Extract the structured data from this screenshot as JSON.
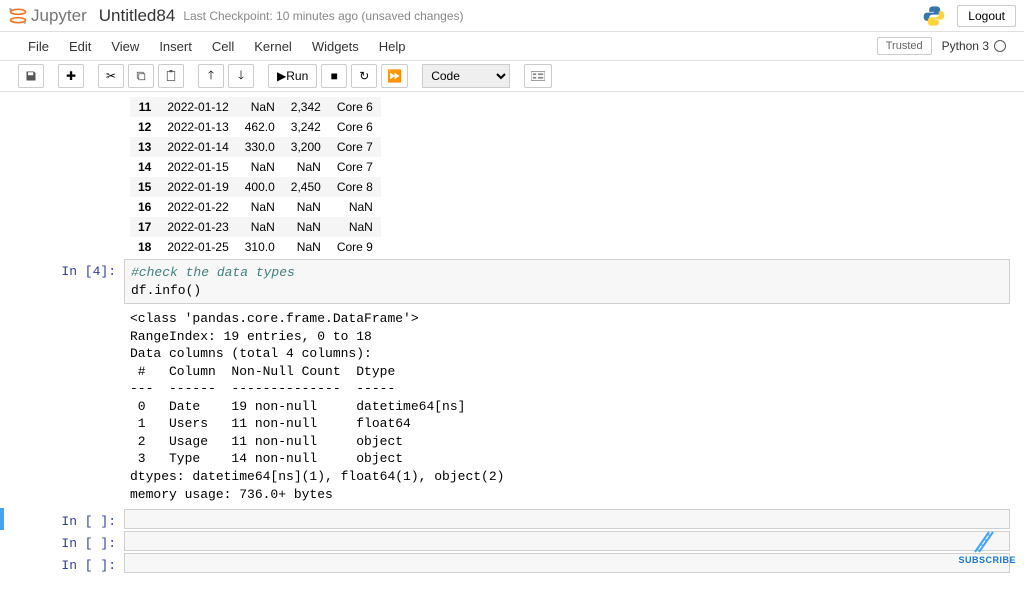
{
  "header": {
    "logo_text": "Jupyter",
    "title": "Untitled84",
    "checkpoint": "Last Checkpoint: 10 minutes ago  (unsaved changes)",
    "logout": "Logout"
  },
  "menubar": {
    "items": [
      "File",
      "Edit",
      "View",
      "Insert",
      "Cell",
      "Kernel",
      "Widgets",
      "Help"
    ],
    "trusted": "Trusted",
    "kernel_name": "Python 3"
  },
  "toolbar": {
    "run_label": "Run",
    "cell_type": "Code"
  },
  "table": {
    "rows": [
      {
        "idx": "11",
        "date": "2022-01-12",
        "users": "NaN",
        "usage": "2,342",
        "type": "Core 6"
      },
      {
        "idx": "12",
        "date": "2022-01-13",
        "users": "462.0",
        "usage": "3,242",
        "type": "Core 6"
      },
      {
        "idx": "13",
        "date": "2022-01-14",
        "users": "330.0",
        "usage": "3,200",
        "type": "Core 7"
      },
      {
        "idx": "14",
        "date": "2022-01-15",
        "users": "NaN",
        "usage": "NaN",
        "type": "Core 7"
      },
      {
        "idx": "15",
        "date": "2022-01-19",
        "users": "400.0",
        "usage": "2,450",
        "type": "Core 8"
      },
      {
        "idx": "16",
        "date": "2022-01-22",
        "users": "NaN",
        "usage": "NaN",
        "type": "NaN"
      },
      {
        "idx": "17",
        "date": "2022-01-23",
        "users": "NaN",
        "usage": "NaN",
        "type": "NaN"
      },
      {
        "idx": "18",
        "date": "2022-01-25",
        "users": "310.0",
        "usage": "NaN",
        "type": "Core 9"
      }
    ]
  },
  "cell4": {
    "prompt": "In [4]:",
    "code_comment": "#check the data types",
    "code_line": "df.info()",
    "output": "<class 'pandas.core.frame.DataFrame'>\nRangeIndex: 19 entries, 0 to 18\nData columns (total 4 columns):\n #   Column  Non-Null Count  Dtype\n---  ------  --------------  -----\n 0   Date    19 non-null     datetime64[ns]\n 1   Users   11 non-null     float64\n 2   Usage   11 non-null     object\n 3   Type    14 non-null     object\ndtypes: datetime64[ns](1), float64(1), object(2)\nmemory usage: 736.0+ bytes"
  },
  "empty_prompt": "In [ ]:",
  "subscribe_label": "SUBSCRIBE"
}
